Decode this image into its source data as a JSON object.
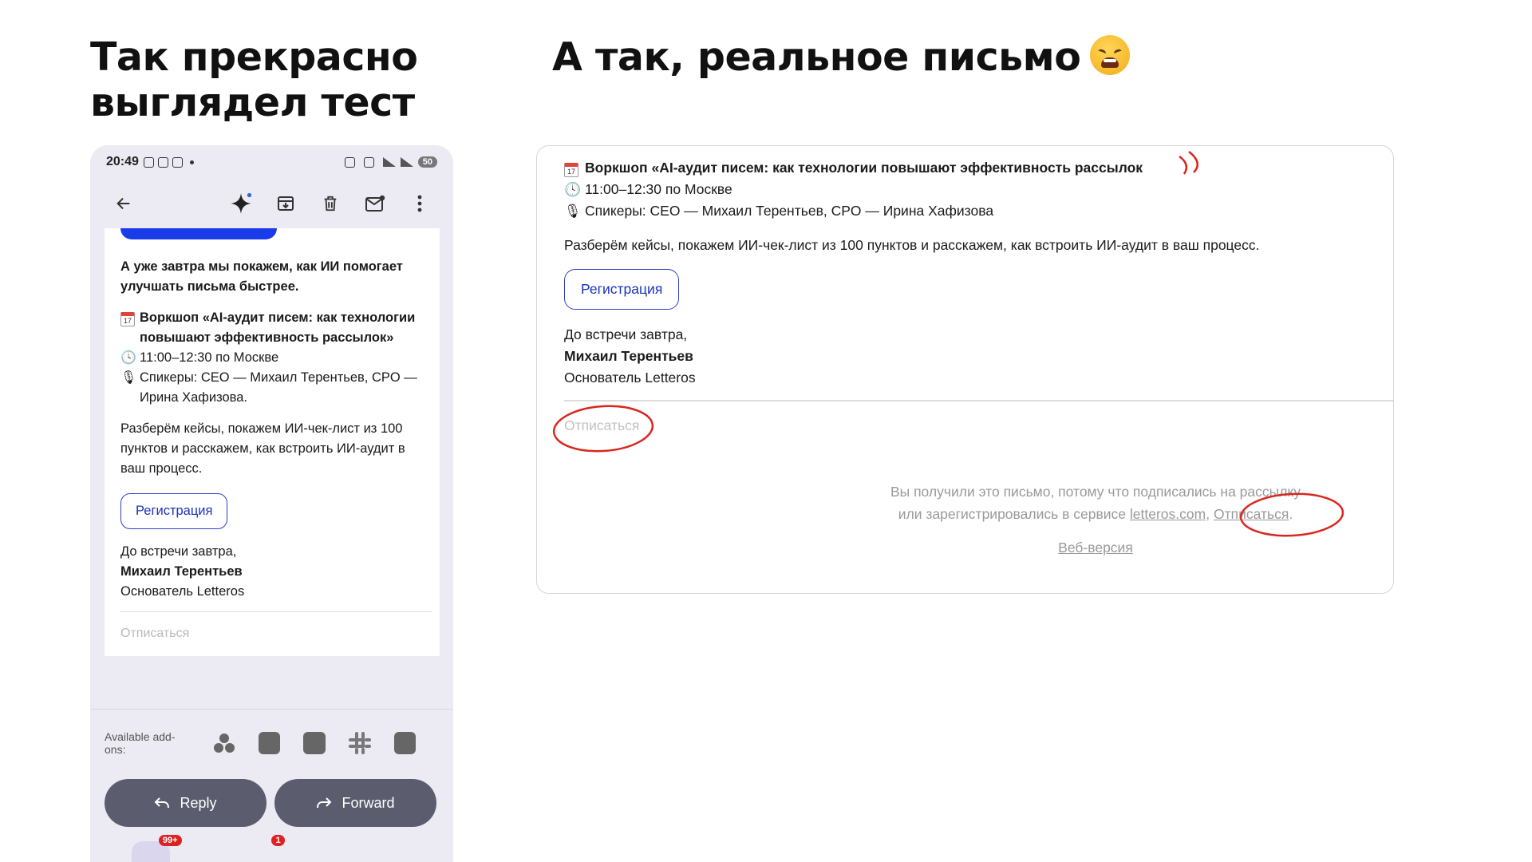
{
  "titles": {
    "left_line1": "Так прекрасно",
    "left_line2": "выглядел тест",
    "right": "А так, реальное письмо"
  },
  "phone": {
    "status_time": "20:49",
    "battery": "50",
    "mail": {
      "intro": "А уже завтра мы покажем, как ИИ помогает улучшать письма быстрее.",
      "workshop": "Воркшоп «AI-аудит писем: как технологии повышают эффективность рассылок»",
      "time": "11:00–12:30 по Москве",
      "speakers": "Спикеры: CEO — Михаил Терентьев, CPO — Ирина Хафизова.",
      "description": "Разберём кейсы, покажем ИИ-чек-лист из 100 пунктов и расскажем, как встроить ИИ-аудит в ваш процесс.",
      "register_label": "Регистрация",
      "closing": "До встречи завтра,",
      "sender_name": "Михаил Терентьев",
      "sender_role": "Основатель Letteros",
      "unsubscribe": "Отписаться"
    },
    "addons_label": "Available add-ons:",
    "reply_label": "Reply",
    "forward_label": "Forward",
    "badge_mail": "99+",
    "badge_chat": "1"
  },
  "email": {
    "workshop": "Воркшоп «AI-аудит писем: как технологии повышают эффективность рассылок",
    "time": "11:00–12:30 по Москве",
    "speakers": "Спикеры: CEO — Михаил Терентьев, CPO — Ирина Хафизова",
    "description": "Разберём кейсы, покажем ИИ-чек-лист из 100 пунктов и расскажем, как встроить ИИ-аудит в ваш процесс.",
    "register_label": "Регистрация",
    "closing": "До встречи завтра,",
    "sender_name": "Михаил Терентьев",
    "sender_role": "Основатель Letteros",
    "unsubscribe": "Отписаться",
    "footer_line1": "Вы получили это письмо, потому что подписались на рассылку",
    "footer_line2_prefix": "или зарегистрировались в сервисе",
    "footer_link": "letteros.com",
    "footer_unsubscribe": "Отписаться",
    "web_version": "Веб-версия"
  },
  "annotation_color": "#d9271f"
}
